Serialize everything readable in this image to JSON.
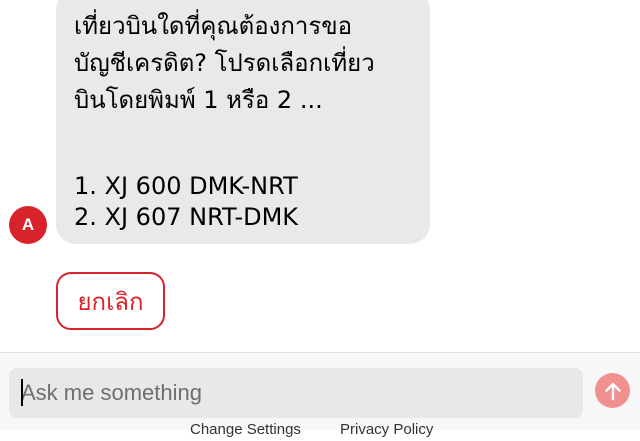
{
  "message": {
    "avatar_letter": "A",
    "lines": [
      "เที่ยวบินใดที่คุณต้องการขอ",
      "บัญชีเครดิต? โปรดเลือกเที่ยว",
      "บินโดยพิมพ์ 1 หรือ 2 ..."
    ],
    "options": [
      "1. XJ 600 DMK-NRT",
      "2. XJ 607 NRT-DMK"
    ]
  },
  "actions": {
    "cancel_label": "ยกเลิก"
  },
  "composer": {
    "placeholder": "Ask me something",
    "value": ""
  },
  "footer": {
    "links": [
      "Change Settings",
      "Privacy Policy"
    ]
  },
  "colors": {
    "brand_red": "#d8232a",
    "send_button": "#f0918f",
    "bubble_bg": "#e9e9eb",
    "input_bg": "#e8e8e8"
  },
  "icons": {
    "send": "arrow-up-icon"
  }
}
